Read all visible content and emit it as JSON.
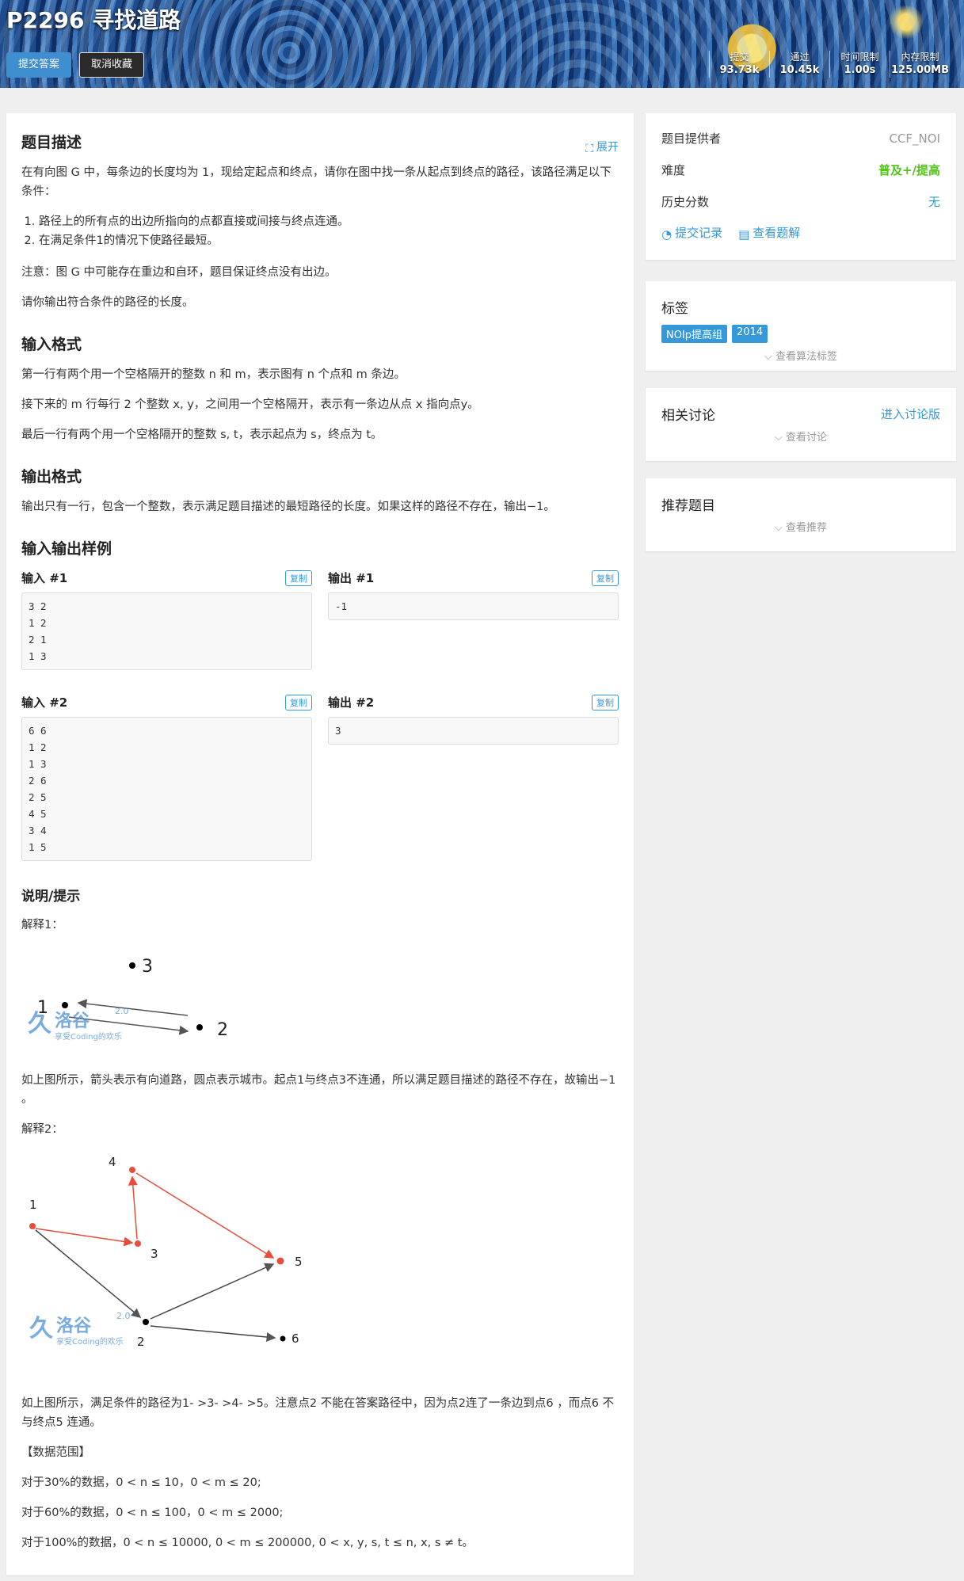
{
  "header": {
    "title": "P2296 寻找道路",
    "submit_label": "提交答案",
    "unfav_label": "取消收藏",
    "stats": [
      {
        "key": "提交",
        "value": "93.73k"
      },
      {
        "key": "通过",
        "value": "10.45k"
      },
      {
        "key": "时间限制",
        "value": "1.00s"
      },
      {
        "key": "内存限制",
        "value": "125.00MB"
      }
    ]
  },
  "problem": {
    "desc_title": "题目描述",
    "expand_label": "展开",
    "desc_p1": "在有向图 G 中，每条边的长度均为 1，现给定起点和终点，请你在图中找一条从起点到终点的路径，该路径满足以下条件：",
    "conditions": [
      "路径上的所有点的出边所指向的点都直接或间接与终点连通。",
      "在满足条件1的情况下使路径最短。"
    ],
    "desc_note": "注意：图 G 中可能存在重边和自环，题目保证终点没有出边。",
    "desc_ask": "请你输出符合条件的路径的长度。",
    "input_title": "输入格式",
    "input_p1": "第一行有两个用一个空格隔开的整数 n 和 m，表示图有 n 个点和 m 条边。",
    "input_p2": "接下来的 m 行每行 2 个整数 x, y，之间用一个空格隔开，表示有一条边从点 x 指向点y。",
    "input_p3": "最后一行有两个用一个空格隔开的整数 s, t，表示起点为 s，终点为 t。",
    "output_title": "输出格式",
    "output_p1": "输出只有一行，包含一个整数，表示满足题目描述的最短路径的长度。如果这样的路径不存在，输出−1。",
    "samples_title": "输入输出样例",
    "copy_label": "复制",
    "samples": [
      {
        "in_label": "输入 #1",
        "out_label": "输出 #1",
        "in": "3 2\n1 2\n2 1\n1 3",
        "out": "-1"
      },
      {
        "in_label": "输入 #2",
        "out_label": "输出 #2",
        "in": "6 6\n1 2\n1 3\n2 6\n2 5\n4 5\n3 4\n1 5",
        "out": "3"
      }
    ],
    "hint_title": "说明/提示",
    "exp1_label": "解释1：",
    "exp1_text": "如上图所示，箭头表示有向道路，圆点表示城市。起点1与终点3不连通，所以满足题目描述的路径不存在，故输出−1 。",
    "exp2_label": "解释2：",
    "exp2_text": "如上图所示，满足条件的路径为1- >3- >4- >5。注意点2 不能在答案路径中，因为点2连了一条边到点6 ，而点6 不与终点5 连通。",
    "range_title": "【数据范围】",
    "range_30": "对于30%的数据，0 < n ≤ 10，0 < m ≤ 20;",
    "range_60": "对于60%的数据，0 < n ≤ 100，0 < m ≤ 2000;",
    "range_100": "对于100%的数据，0 < n ≤ 10000, 0 < m ≤ 200000, 0 < x, y, s, t ≤ n, x, s ≠ t。",
    "watermark_text": "洛谷",
    "watermark_ver": "2.0",
    "watermark_sub": "享受Coding的欢乐",
    "fig1_nodes": [
      "3",
      "1",
      "2"
    ],
    "fig2_nodes": [
      "4",
      "1",
      "3",
      "5",
      "2",
      "6"
    ]
  },
  "sidebar": {
    "provider_label": "题目提供者",
    "provider_value": "CCF_NOI",
    "difficulty_label": "难度",
    "difficulty_value": "普及+/提高",
    "history_label": "历史分数",
    "history_value": "无",
    "records_label": "提交记录",
    "solutions_label": "查看题解",
    "tags_title": "标签",
    "tags": [
      "NOIp提高组",
      "2014"
    ],
    "tags_more": "查看算法标签",
    "discuss_title": "相关讨论",
    "discuss_link": "进入讨论版",
    "discuss_more": "查看讨论",
    "recommend_title": "推荐题目",
    "recommend_more": "查看推荐"
  },
  "colors": {
    "accent": "#3498db",
    "difficulty": "#52c41a",
    "edge_red": "#e74c3c"
  }
}
